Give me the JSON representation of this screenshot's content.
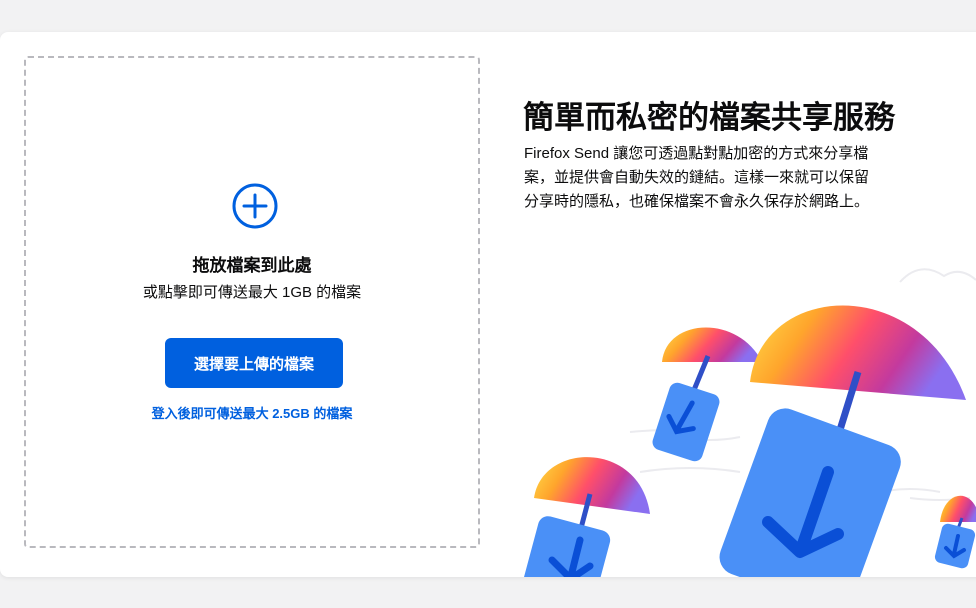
{
  "upload": {
    "drop_title": "拖放檔案到此處",
    "drop_subtitle": "或點擊即可傳送最大 1GB 的檔案",
    "select_button": "選擇要上傳的檔案",
    "signin_hint": "登入後即可傳送最大 2.5GB 的檔案"
  },
  "intro": {
    "title": "簡單而私密的檔案共享服務",
    "description": "Firefox Send 讓您可透過點對點加密的方式來分享檔案，並提供會自動失效的鏈結。這樣一來就可以保留分享時的隱私，也確保檔案不會永久保存於網路上。"
  },
  "icons": {
    "add": "plus-circle-icon",
    "illustration": "parachute-files-illustration"
  },
  "colors": {
    "accent": "#0060df",
    "file_blue": "#4a90f7",
    "arrow_blue": "#0a4fd6"
  }
}
